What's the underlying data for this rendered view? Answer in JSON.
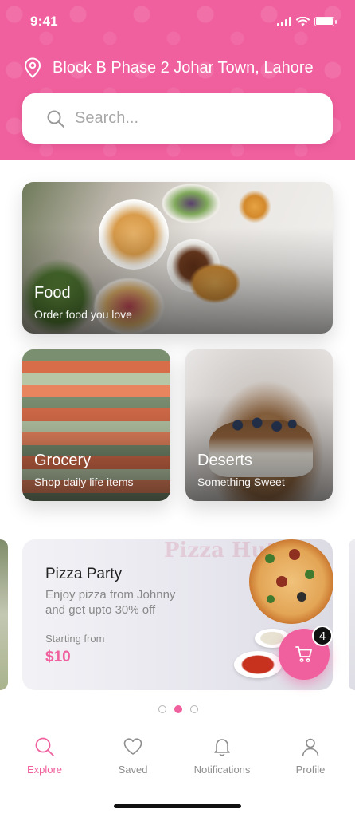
{
  "status_bar": {
    "time": "9:41"
  },
  "header": {
    "location": "Block B Phase 2 Johar Town, Lahore",
    "search_placeholder": "Search..."
  },
  "categories": [
    {
      "title": "Food",
      "subtitle": "Order food you love"
    },
    {
      "title": "Grocery",
      "subtitle": "Shop daily life items"
    },
    {
      "title": "Deserts",
      "subtitle": "Something Sweet"
    }
  ],
  "promo": {
    "brand": "Pizza Hut",
    "title": "Pizza Party",
    "description": "Enjoy pizza from Johnny and get upto 30% off",
    "starting_label": "Starting from",
    "price": "$10"
  },
  "cart": {
    "count": "4"
  },
  "carousel": {
    "total": 3,
    "active": 1
  },
  "tabs": [
    {
      "label": "Explore",
      "icon": "search-icon",
      "active": true
    },
    {
      "label": "Saved",
      "icon": "heart-icon",
      "active": false
    },
    {
      "label": "Notifications",
      "icon": "bell-icon",
      "active": false
    },
    {
      "label": "Profile",
      "icon": "user-icon",
      "active": false
    }
  ],
  "colors": {
    "accent": "#f0609e",
    "badge": "#111111"
  }
}
